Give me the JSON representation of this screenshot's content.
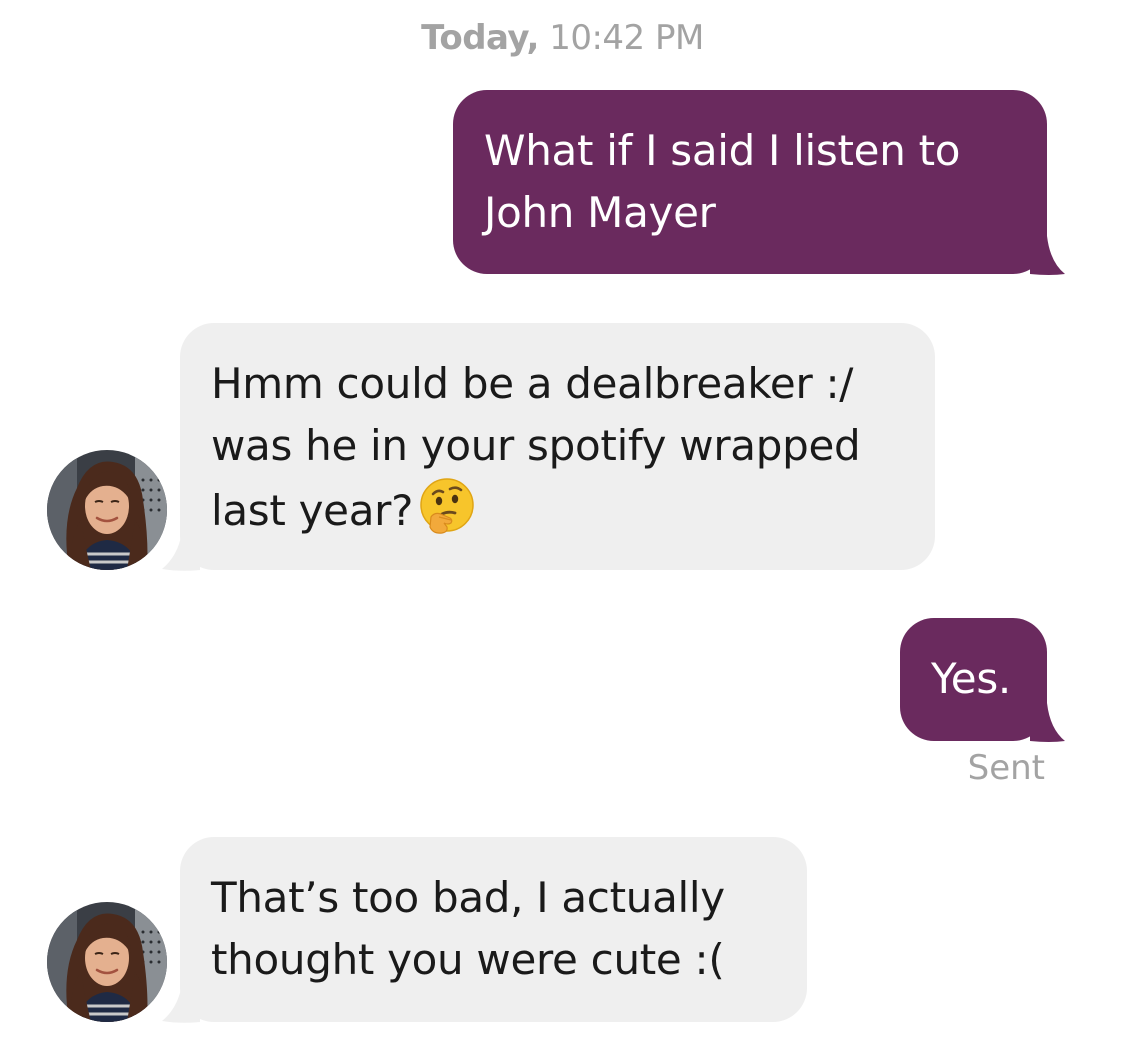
{
  "conversation": {
    "timestamp": {
      "day": "Today,",
      "time": "10:42 PM"
    },
    "messages": [
      {
        "direction": "outgoing",
        "text": "What if I said I listen to John Mayer"
      },
      {
        "direction": "incoming",
        "text": "Hmm could be a dealbreaker :/ was he in your spotify wrapped last year?",
        "emoji": "thinking-face"
      },
      {
        "direction": "outgoing",
        "text": "Yes."
      },
      {
        "direction": "incoming",
        "text": "That’s too bad, I actually thought you were cute :("
      }
    ],
    "sent_status": "Sent"
  },
  "colors": {
    "outgoing_bubble": "#6a2a5e",
    "incoming_bubble": "#efefef",
    "timestamp_text": "#a3a3a3"
  }
}
